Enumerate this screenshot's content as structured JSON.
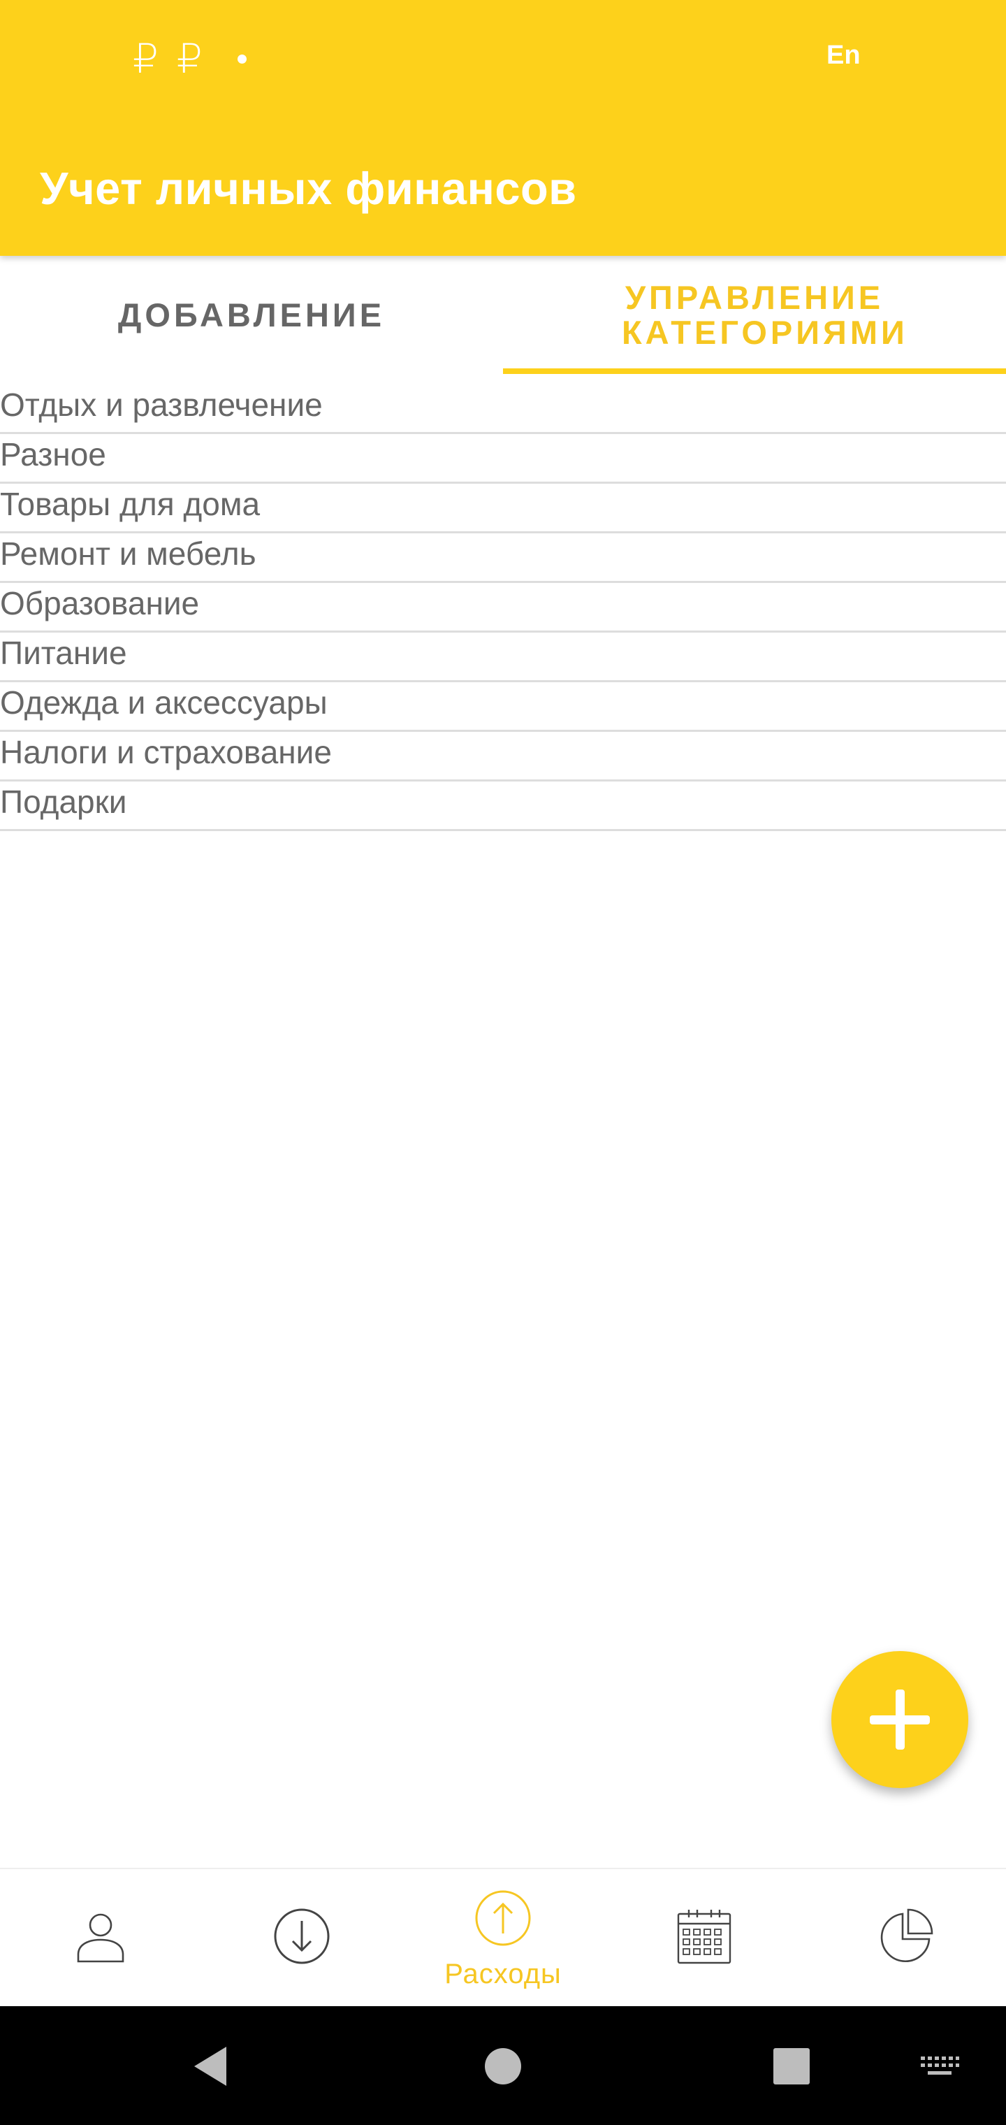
{
  "status_bar": {
    "left_icons": [
      "ruble-icon",
      "ruble-icon",
      "dot-icon"
    ],
    "ruble_1": "₽",
    "ruble_2": "₽",
    "language": "En"
  },
  "header": {
    "title": "Учет личных финансов"
  },
  "tabs": [
    {
      "label": "Добавление",
      "active": false
    },
    {
      "label": "Управление категориями",
      "active": true
    }
  ],
  "categories": [
    "Отдых и развлечение",
    "Разное",
    "Товары для дома",
    "Ремонт и мебель",
    "Образование",
    "Питание",
    "Одежда и аксессуары",
    "Налоги и страхование",
    "Подарки"
  ],
  "fab": {
    "icon": "plus-icon"
  },
  "bottom_nav": [
    {
      "icon": "person-icon",
      "label": ""
    },
    {
      "icon": "arrow-down-circle-icon",
      "label": ""
    },
    {
      "icon": "arrow-up-circle-icon",
      "label": "Расходы",
      "active": true
    },
    {
      "icon": "calendar-icon",
      "label": ""
    },
    {
      "icon": "pie-chart-icon",
      "label": ""
    }
  ],
  "system_nav": [
    "back-icon",
    "home-icon",
    "recents-icon",
    "keyboard-icon"
  ],
  "colors": {
    "accent": "#FDD11B",
    "accent_text": "#F6C622",
    "text": "#676767",
    "divider": "#dddddd"
  }
}
